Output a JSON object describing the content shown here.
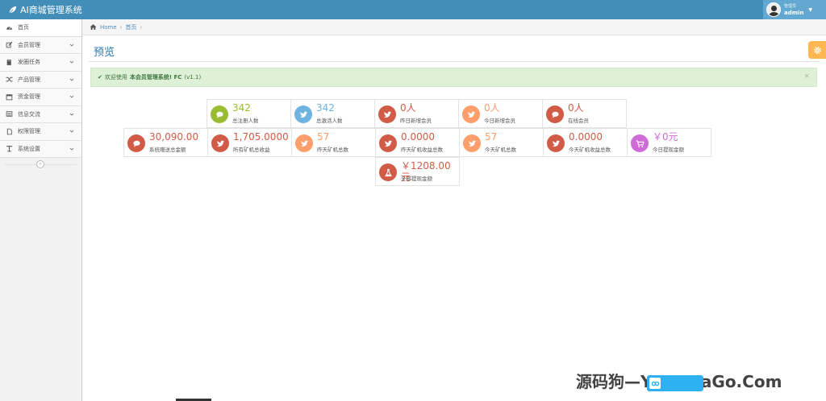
{
  "navbar": {
    "title": "AI商城管理系统"
  },
  "user": {
    "role": "管理员",
    "name": "admin"
  },
  "sidebar": {
    "items": [
      {
        "label": "首页",
        "icon": "dashboard-icon",
        "expandable": false
      },
      {
        "label": "会员管理",
        "icon": "edit-icon",
        "expandable": true
      },
      {
        "label": "发圈任务",
        "icon": "book-icon",
        "expandable": true
      },
      {
        "label": "产品管理",
        "icon": "shuffle-icon",
        "expandable": true
      },
      {
        "label": "资金管理",
        "icon": "calendar-icon",
        "expandable": true
      },
      {
        "label": "信息交流",
        "icon": "list-icon",
        "expandable": true
      },
      {
        "label": "权限管理",
        "icon": "file-icon",
        "expandable": true
      },
      {
        "label": "系统设置",
        "icon": "text-icon",
        "expandable": true
      }
    ]
  },
  "breadcrumbs": {
    "home": "Home",
    "current": "首页"
  },
  "page": {
    "title": "预览"
  },
  "alert": {
    "prefix": "欢迎使用",
    "highlight": "本会员管理系统! FC",
    "suffix": "(v1.1)"
  },
  "stats": [
    {
      "value": "342",
      "label": "总注册人数",
      "color": "#9abc32",
      "icon": "comments-icon"
    },
    {
      "value": "342",
      "label": "总激活人数",
      "color": "#6fb3e0",
      "icon": "twitter-icon"
    },
    {
      "value": "0人",
      "label": "昨日新增会员",
      "color": "#d15b47",
      "icon": "twitter-icon"
    },
    {
      "value": "0人",
      "label": "今日新增会员",
      "color": "#fe9e6b",
      "icon": "twitter-icon"
    },
    {
      "value": "0人",
      "label": "在线会员",
      "color": "#d15b47",
      "icon": "comments-icon"
    },
    {
      "value": "30,090.00",
      "label": "系统赠送总金额",
      "color": "#d15b47",
      "icon": "comments-icon"
    },
    {
      "value": "1,705.0000",
      "label": "所有矿机总收益",
      "color": "#d15b47",
      "icon": "twitter-icon"
    },
    {
      "value": "57",
      "label": "昨天矿机总数",
      "color": "#fe9e6b",
      "icon": "twitter-icon"
    },
    {
      "value": "0.0000",
      "label": "昨天矿机收益总数",
      "color": "#d15b47",
      "icon": "twitter-icon"
    },
    {
      "value": "57",
      "label": "今天矿机总数",
      "color": "#fe9e6b",
      "icon": "twitter-icon"
    },
    {
      "value": "0.0000",
      "label": "今天矿机收益总数",
      "color": "#d15b47",
      "icon": "twitter-icon"
    },
    {
      "value": "￥0元",
      "label": "今日提现金额",
      "color": "#cf6bd6",
      "icon": "cart-icon"
    },
    {
      "value": "￥1208.00元",
      "label": "全部提现金额",
      "color": "#d15b47",
      "icon": "flask-icon"
    }
  ],
  "watermark": "源码狗—YuanMaGo.Com"
}
